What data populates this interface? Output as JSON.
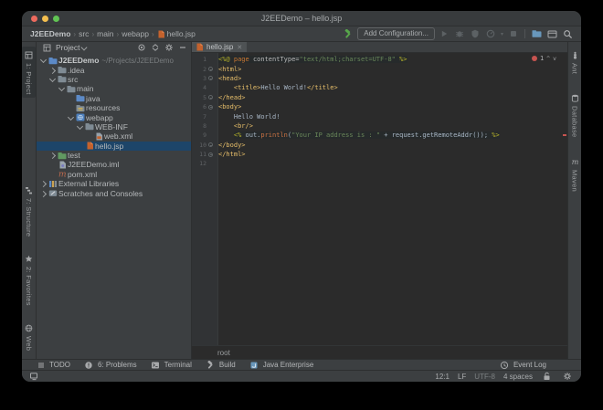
{
  "titlebar": {
    "title": "J2EEDemo – hello.jsp"
  },
  "navbar": {
    "breadcrumb": {
      "project": "J2EEDemo",
      "path": [
        "src",
        "main",
        "webapp"
      ],
      "file": "hello.jsp",
      "separator": "›"
    },
    "add_configuration": "Add Configuration...",
    "build_tool": {
      "name": "build-hammer",
      "icon": "hammer-green"
    },
    "run_tools": [
      {
        "name": "run-button",
        "icon": "play",
        "disabled": true
      },
      {
        "name": "debug-button",
        "icon": "bug",
        "disabled": true
      },
      {
        "name": "coverage-button",
        "icon": "coverage",
        "disabled": true
      },
      {
        "name": "profiler-button",
        "icon": "profiler",
        "disabled": true,
        "dropdown": true
      },
      {
        "name": "stop-button",
        "icon": "stop",
        "disabled": true
      }
    ],
    "right_tools": [
      {
        "name": "open-project-button",
        "icon": "tool-folder"
      },
      {
        "name": "layout-button",
        "icon": "tool-window"
      },
      {
        "name": "search-everywhere-button",
        "icon": "search"
      }
    ]
  },
  "project_panel": {
    "title": "Project",
    "header_icons": [
      {
        "name": "locate-file-button",
        "icon": "target"
      },
      {
        "name": "collapse-all-button",
        "icon": "collapse"
      },
      {
        "name": "settings-button",
        "icon": "gear"
      },
      {
        "name": "hide-panel-button",
        "icon": "minus"
      }
    ],
    "tree": [
      {
        "indent": 0,
        "chevron": "open",
        "icon": "folder-blue",
        "label": "J2EEDemo",
        "suffix": "~/Projects/J2EEDemo",
        "bold": true
      },
      {
        "indent": 1,
        "chevron": "closed",
        "icon": "folder",
        "label": ".idea"
      },
      {
        "indent": 1,
        "chevron": "open",
        "icon": "folder",
        "label": "src"
      },
      {
        "indent": 2,
        "chevron": "open",
        "icon": "folder",
        "label": "main"
      },
      {
        "indent": 3,
        "chevron": null,
        "icon": "folder-blue",
        "label": "java"
      },
      {
        "indent": 3,
        "chevron": null,
        "icon": "folder-res",
        "label": "resources"
      },
      {
        "indent": 3,
        "chevron": "open",
        "icon": "webapp",
        "label": "webapp"
      },
      {
        "indent": 4,
        "chevron": "open",
        "icon": "folder",
        "label": "WEB-INF"
      },
      {
        "indent": 5,
        "chevron": null,
        "icon": "webxml",
        "label": "web.xml"
      },
      {
        "indent": 4,
        "chevron": null,
        "icon": "jsp",
        "label": "hello.jsp",
        "selected": true
      },
      {
        "indent": 1,
        "chevron": "closed",
        "icon": "folder-test",
        "label": "test"
      },
      {
        "indent": 1,
        "chevron": null,
        "icon": "iml",
        "label": "J2EEDemo.iml"
      },
      {
        "indent": 1,
        "chevron": null,
        "icon": "maven",
        "label": "pom.xml"
      },
      {
        "indent": 0,
        "chevron": "closed",
        "icon": "libs",
        "label": "External Libraries"
      },
      {
        "indent": 0,
        "chevron": "closed",
        "icon": "scratch",
        "label": "Scratches and Consoles"
      }
    ]
  },
  "editor": {
    "tab": {
      "label": "hello.jsp",
      "icon": "jsp",
      "close": "✕"
    },
    "inspection": {
      "errors": "1",
      "prev": "^",
      "next": "v"
    },
    "breadcrumb": "root",
    "lines": [
      {
        "n": "1",
        "band_start": 0,
        "tokens": [
          [
            "jsp",
            "<%@ "
          ],
          [
            "kw",
            "page "
          ],
          [
            "attr",
            "contentType="
          ],
          [
            "str",
            "\"text/html;charset=UTF-8\""
          ],
          [
            "plain",
            " "
          ],
          [
            "jsp",
            "%>"
          ]
        ]
      },
      {
        "n": "2",
        "fold": true,
        "tokens": [
          [
            "tag",
            "<html>"
          ]
        ]
      },
      {
        "n": "3",
        "fold": true,
        "tokens": [
          [
            "tag",
            "<head>"
          ]
        ]
      },
      {
        "n": "4",
        "tokens": [
          [
            "plain",
            "    "
          ],
          [
            "tag",
            "<title>"
          ],
          [
            "plain",
            "Hello World!"
          ],
          [
            "tag",
            "</title>"
          ]
        ]
      },
      {
        "n": "5",
        "fold": true,
        "tokens": [
          [
            "tag",
            "</head>"
          ]
        ]
      },
      {
        "n": "6",
        "fold": true,
        "tokens": [
          [
            "tag",
            "<body>"
          ]
        ]
      },
      {
        "n": "7",
        "tokens": [
          [
            "plain",
            "    Hello World!"
          ]
        ]
      },
      {
        "n": "8",
        "tokens": [
          [
            "plain",
            "    "
          ],
          [
            "tag",
            "<br/>"
          ]
        ]
      },
      {
        "n": "9",
        "band_start": 1,
        "tokens": [
          [
            "plain",
            "    "
          ],
          [
            "jsp",
            "<% "
          ],
          [
            "plain",
            "out."
          ],
          [
            "method",
            "println"
          ],
          [
            "plain",
            "("
          ],
          [
            "str",
            "\"Your IP address is : \""
          ],
          [
            "plain",
            " + request.getRemoteAddr()); "
          ],
          [
            "jsp",
            "%>"
          ]
        ]
      },
      {
        "n": "10",
        "fold": true,
        "tokens": [
          [
            "tag",
            "</body>"
          ]
        ]
      },
      {
        "n": "11",
        "fold": true,
        "tokens": [
          [
            "tag",
            "</html>"
          ]
        ]
      },
      {
        "n": "12",
        "tokens": []
      }
    ]
  },
  "tool_stripes": {
    "left_top": [
      {
        "label": "1: Project",
        "icon": "project-stripe",
        "active": true
      }
    ],
    "left_bottom": [
      {
        "label": "7: Structure",
        "icon": "structure"
      },
      {
        "label": "2: Favorites",
        "icon": "star"
      },
      {
        "label": "Web",
        "icon": "globe"
      }
    ],
    "right": [
      {
        "label": "Ant",
        "icon": "ant"
      },
      {
        "label": "Database",
        "icon": "database"
      },
      {
        "label": "Maven",
        "icon": "maven-stripe"
      }
    ]
  },
  "bottom_bar": {
    "left": [
      {
        "label": "TODO",
        "icon": "todo",
        "name": "todo-button"
      },
      {
        "label": "6: Problems",
        "icon": "problems",
        "name": "problems-button"
      },
      {
        "label": "Terminal",
        "icon": "terminal",
        "name": "terminal-button"
      },
      {
        "label": "Build",
        "icon": "hammer-sm",
        "name": "build-panel-button"
      },
      {
        "label": "Java Enterprise",
        "icon": "jee",
        "name": "java-enterprise-button"
      }
    ],
    "right": [
      {
        "label": "Event Log",
        "icon": "clock",
        "name": "event-log-button"
      }
    ]
  },
  "status_bar": {
    "caret": "12:1",
    "line_separator": "LF",
    "encoding": "UTF-8",
    "indent": "4 spaces",
    "icons": [
      {
        "name": "lock-icon",
        "icon": "lock"
      },
      {
        "name": "notifications-settings-icon",
        "icon": "gear"
      }
    ]
  },
  "colors": {
    "selection_blue": "#1D4569",
    "error_red": "#C75450",
    "build_green": "#57A64A",
    "jsp_orange": "#C4622D",
    "editor_bg": "#2B2B2B",
    "panel_bg": "#3C3F41"
  }
}
